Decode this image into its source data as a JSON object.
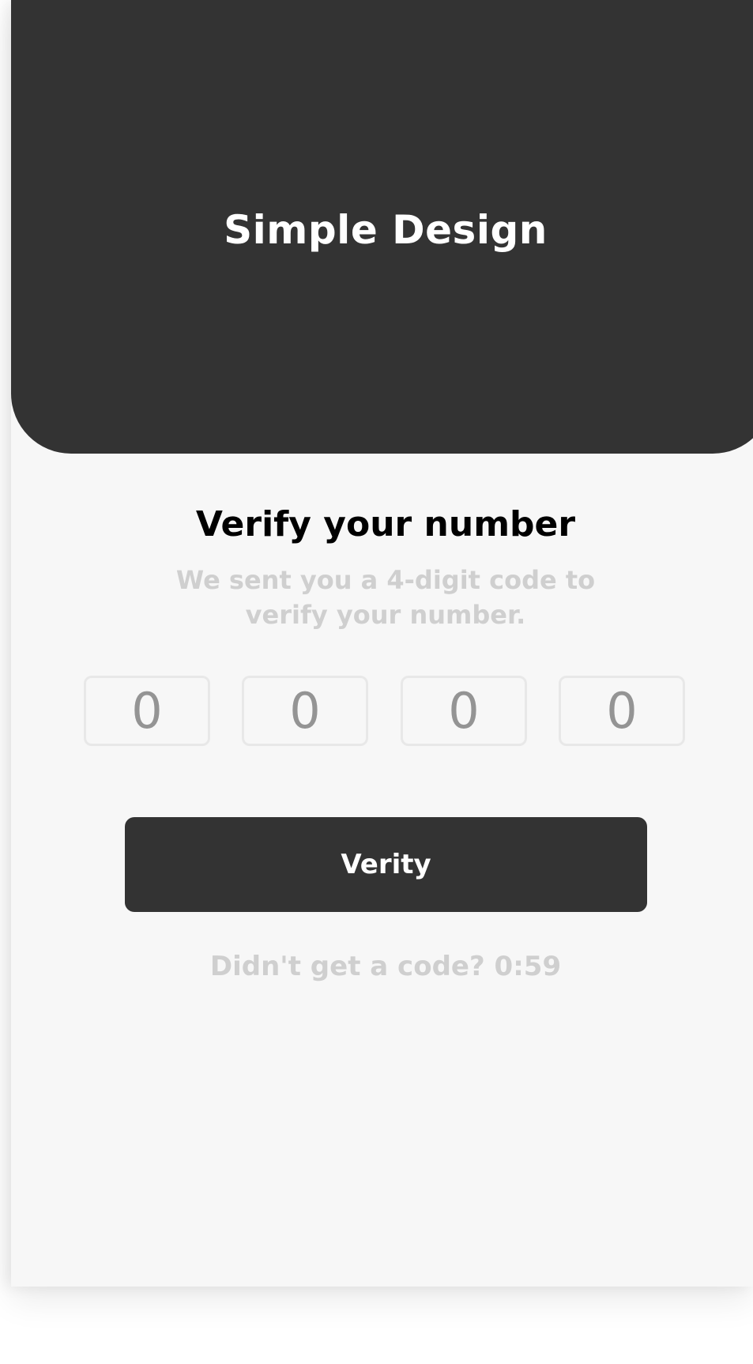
{
  "hero": {
    "title": "Simple Design"
  },
  "verify": {
    "heading": "Verify your number",
    "subtitle": "We sent you a 4-digit code to verify your number.",
    "code_placeholders": [
      "0",
      "0",
      "0",
      "0"
    ],
    "button_label": "Verity",
    "resend_text": "Didn't get a code? 0:59"
  },
  "colors": {
    "primary": "#333333",
    "background": "#f7f7f7",
    "muted_text": "#cfcfcf",
    "placeholder": "#949494"
  }
}
